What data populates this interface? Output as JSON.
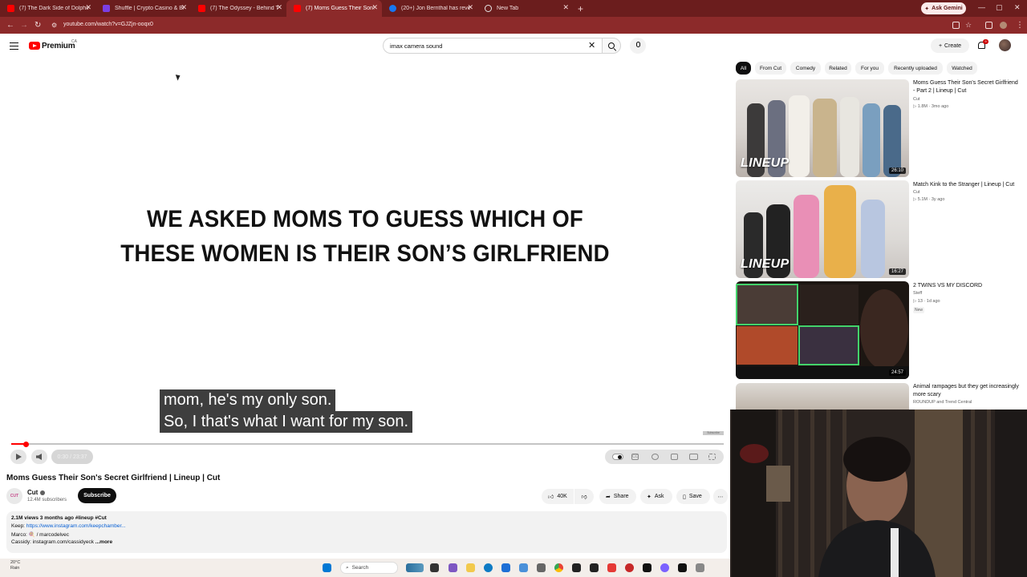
{
  "browser": {
    "tabs": [
      {
        "title": "(7) The Dark Side of Dolphins T",
        "favicon_color": "#ff0000"
      },
      {
        "title": "Shuffle | Crypto Casino & Bitco",
        "favicon_color": "#7b3fe4"
      },
      {
        "title": "(7) The Odyssey - Behind The S",
        "favicon_color": "#ff0000"
      },
      {
        "title": "(7) Moms Guess Their Son's Se",
        "favicon_color": "#ff0000",
        "active": true
      },
      {
        "title": "(20+) Jon Bernthal has revealed",
        "favicon_color": "#1877f2"
      },
      {
        "title": "New Tab",
        "favicon_color": "#9aa0a6"
      }
    ],
    "ask_gemini": "Ask Gemini",
    "url": "youtube.com/watch?v=GJZjn-ooqx0"
  },
  "header": {
    "logo_text": "Premium",
    "region": "CA",
    "search_value": "imax camera sound",
    "create_label": "Create",
    "notification_count": "9"
  },
  "player": {
    "headline_line1": "WE ASKED MOMS TO GUESS WHICH OF",
    "headline_line2": "THESE WOMEN IS THEIR SON’S GIRLFRIEND",
    "caption_line1": "mom, he's my only son.",
    "caption_line2": "So, I that's what I want for my son.",
    "time_display": "0:30 / 23:37",
    "progress_fraction": 0.021,
    "watermark": "Subscribe"
  },
  "video": {
    "title": "Moms Guess Their Son's Secret Girlfriend | Lineup | Cut",
    "channel": "Cut",
    "channel_avatar_text": "CUT",
    "subscribers": "12.4M subscribers",
    "subscribe_label": "Subscribe",
    "likes": "40K",
    "share_label": "Share",
    "ask_label": "Ask",
    "save_label": "Save",
    "description": {
      "meta": "2.1M views  3 months ago  #lineup #Cut",
      "keep_label": "Keep: ",
      "keep_link": "https://www.instagram.com/keepchamber...",
      "marco": "Marco: 🍭 / marcodelvec",
      "cassidy": "Cassidy: instagram.com/cassidyeck",
      "more": "...more"
    }
  },
  "sidebar": {
    "chips": [
      "All",
      "From Cut",
      "Comedy",
      "Related",
      "For you",
      "Recently uploaded",
      "Watched"
    ],
    "recommendations": [
      {
        "title": "Moms Guess Their Son's Secret Girlfriend - Part 2 | Lineup | Cut",
        "channel": "Cut",
        "meta": "▷ 1.8M · 3mo ago",
        "duration": "26:10",
        "overlay": "LINEUP"
      },
      {
        "title": "Match Kink to the Stranger | Lineup | Cut",
        "channel": "Cut",
        "meta": "▷ 5.1M · 3y ago",
        "duration": "16:27",
        "overlay": "LINEUP"
      },
      {
        "title": "2 TWINS VS MY DISCORD",
        "channel": "Steff",
        "meta": "▷ 13 · 1d ago",
        "duration": "24:57",
        "badge": "New"
      },
      {
        "title": "Animal rampages but they get increasingly more scary",
        "channel": "ROUNDUP and Trend Central",
        "meta": "",
        "duration": ""
      }
    ]
  },
  "taskbar": {
    "temperature": "20°C",
    "condition": "Rain",
    "search_label": "Search"
  }
}
